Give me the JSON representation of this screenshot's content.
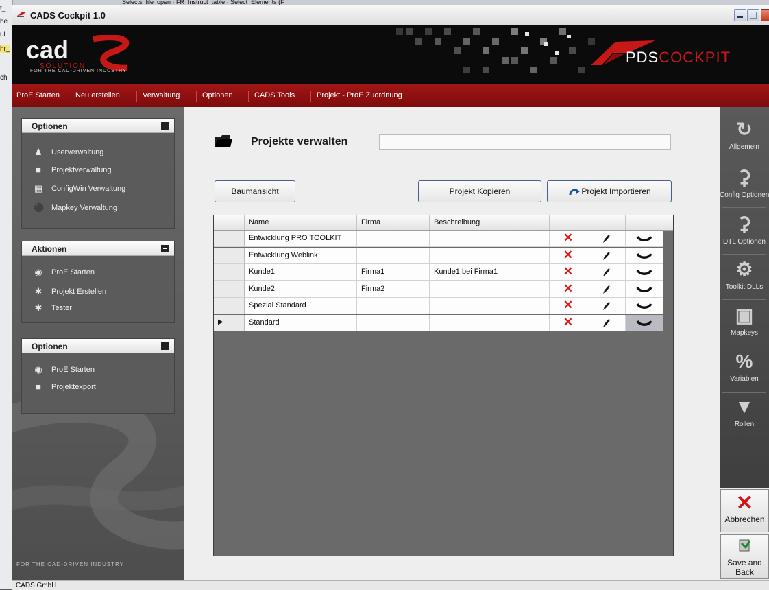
{
  "background_fragments": {
    "tab_text": "Selects_file_open · FR_Instruct_table · Select_Elements (F",
    "left_fragments": [
      "t_",
      "be",
      "ul",
      "hr_",
      "ch"
    ]
  },
  "window": {
    "title": "CADS Cockpit 1.0"
  },
  "banner": {
    "cads_logo_text": "cad",
    "solution_text": "SOLUTION",
    "tagline": "FOR THE CAD-DRIVEN INDUSTRY",
    "pds_prefix": "PDS",
    "pds_suffix": "COCKPIT"
  },
  "menu": {
    "items": [
      "ProE Starten",
      "Neu erstellen",
      "Verwaltung",
      "Optionen",
      "CADS Tools",
      "Projekt - ProE Zuordnung"
    ]
  },
  "sidebar": {
    "panel1": {
      "title": "Optionen",
      "items": [
        "Userverwaltung",
        "Projektverwaltung",
        "ConfigWin Verwaltung",
        "Mapkey Verwaltung"
      ]
    },
    "panel2": {
      "title": "Aktionen",
      "items": [
        "ProE Starten",
        "Projekt Erstellen",
        "Tester"
      ]
    },
    "panel3": {
      "title": "Optionen",
      "items": [
        "ProE Starten",
        "Projektexport"
      ]
    },
    "footer": "FOR THE CAD-DRIVEN INDUSTRY"
  },
  "content": {
    "heading": "Projekte verwalten",
    "search_value": "",
    "buttons": {
      "tree": "Baumansicht",
      "copy": "Projekt Kopieren",
      "import": "Projekt Importieren"
    },
    "table": {
      "columns": [
        "Name",
        "Firma",
        "Beschreibung"
      ],
      "selected_row": 5,
      "rows": [
        {
          "name": "Entwicklung PRO TOOLKIT",
          "firma": "",
          "beschreibung": ""
        },
        {
          "name": "Entwicklung Weblink",
          "firma": "",
          "beschreibung": ""
        },
        {
          "name": "Kunde1",
          "firma": "Firma1",
          "beschreibung": "Kunde1 bei Firma1"
        },
        {
          "name": "Kunde2",
          "firma": "Firma2",
          "beschreibung": ""
        },
        {
          "name": "Spezial Standard",
          "firma": "",
          "beschreibung": ""
        },
        {
          "name": "Standard",
          "firma": "",
          "beschreibung": ""
        }
      ]
    }
  },
  "right_toolbar": {
    "items": [
      "Allgemein",
      "Config Optionen",
      "DTL Optionen",
      "Toolkit DLLs",
      "Mapkeys",
      "Variablen",
      "Rollen"
    ],
    "cancel_label": "Abbrechen",
    "save_label_line1": "Save and",
    "save_label_line2": "Back"
  },
  "status": {
    "text": "CADS GmbH"
  },
  "colors": {
    "menu_red": "#8f1010",
    "accent_red": "#c81717",
    "delete_red": "#e01616"
  }
}
